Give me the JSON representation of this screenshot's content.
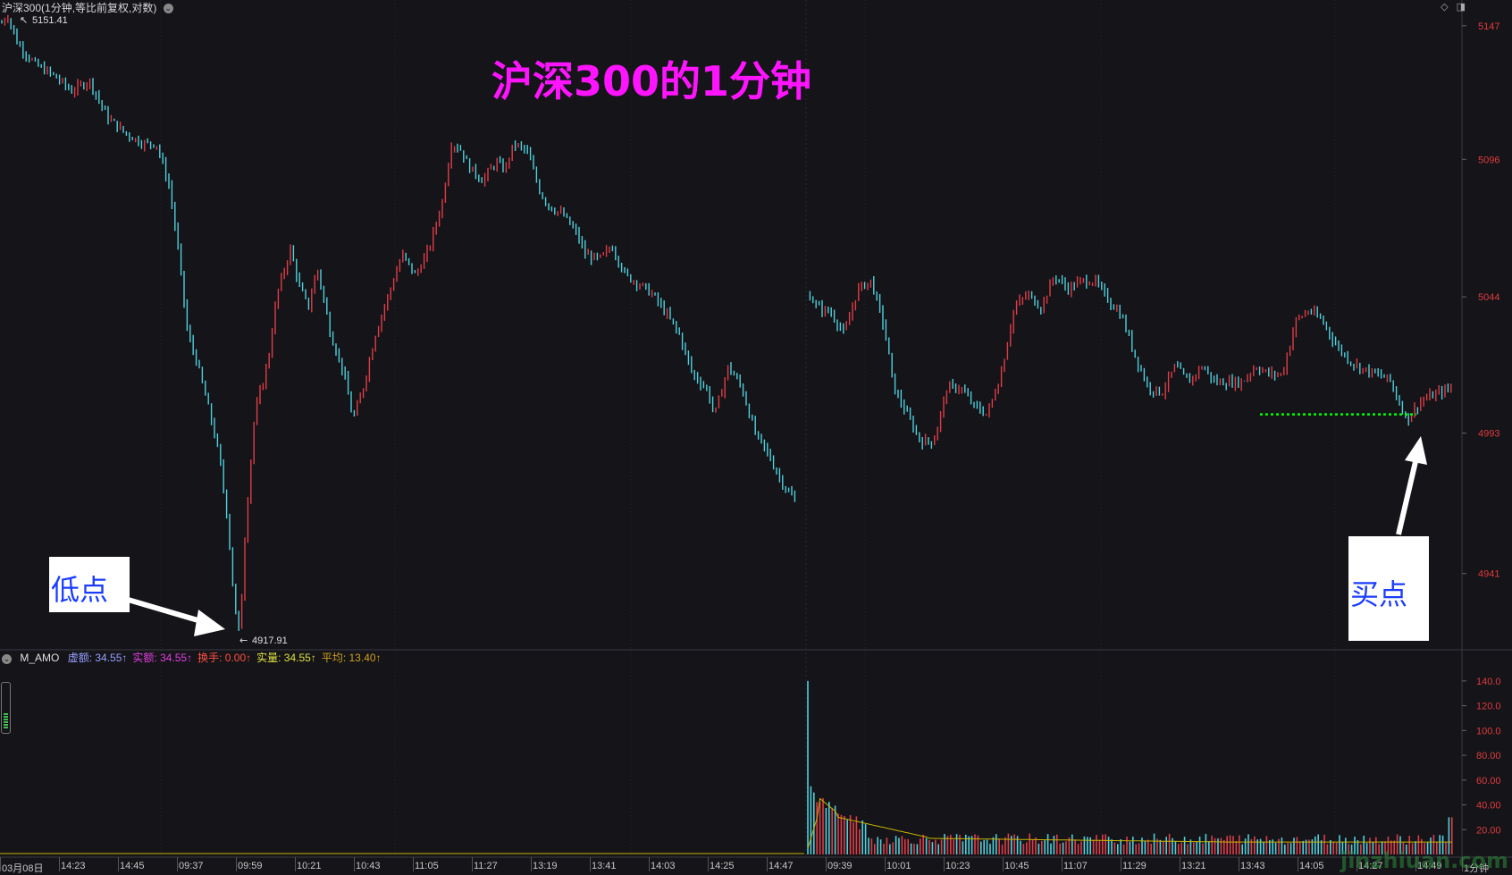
{
  "window": {
    "title": "沪深300(1分钟,等比前复权,对数)",
    "menu_icon": "chevron-down-icon",
    "controls": [
      "◇",
      "◨"
    ]
  },
  "headline": "沪深300的1分钟",
  "annotations": {
    "low_label": "低点",
    "buy_label": "买点",
    "high_price_label": "5151.41",
    "low_price_label": "4917.91"
  },
  "colors": {
    "background": "#141419",
    "up": "#e03c46",
    "down": "#4fd0dc",
    "headline": "#ff14ff",
    "support_line": "#00ff00",
    "avg_line": "#c8b400"
  },
  "price_axis": {
    "ticks": [
      "5147",
      "5096",
      "5044",
      "4993",
      "4941"
    ]
  },
  "volume_axis": {
    "ticks": [
      "140.0",
      "120.0",
      "100.0",
      "80.00",
      "60.00",
      "40.00",
      "20.00"
    ]
  },
  "indicator": {
    "name": "M_AMO",
    "items": [
      {
        "label": "虚额:",
        "value": "34.55↑",
        "color": "#9aa0ff"
      },
      {
        "label": "实额:",
        "value": "34.55↑",
        "color": "#e040e0"
      },
      {
        "label": "换手:",
        "value": "0.00↑",
        "color": "#ff5040"
      },
      {
        "label": "实量:",
        "value": "34.55↑",
        "color": "#e0e040"
      },
      {
        "label": "平均:",
        "value": "13.40↑",
        "color": "#d0a020"
      }
    ]
  },
  "time_axis": {
    "labels": [
      "03月08日",
      "14:23",
      "14:45",
      "09:37",
      "09:59",
      "10:21",
      "10:43",
      "11:05",
      "11:27",
      "13:19",
      "13:41",
      "14:03",
      "14:25",
      "14:47",
      "09:39",
      "10:01",
      "10:23",
      "10:45",
      "11:07",
      "11:29",
      "13:21",
      "13:43",
      "14:05",
      "14:27",
      "14:49",
      "1分钟"
    ]
  },
  "watermark": "jinzhiuan.com",
  "chart_data": {
    "type": "line",
    "title": "沪深300的1分钟",
    "y_scale": "log",
    "ylim": [
      4917.91,
      5151.41
    ],
    "price_points": [
      [
        0,
        5147
      ],
      [
        8,
        5151.41
      ],
      [
        20,
        5140
      ],
      [
        40,
        5132
      ],
      [
        60,
        5128
      ],
      [
        80,
        5122
      ],
      [
        100,
        5126
      ],
      [
        120,
        5112
      ],
      [
        140,
        5106
      ],
      [
        160,
        5102
      ],
      [
        175,
        5102
      ],
      [
        190,
        5085
      ],
      [
        200,
        5060
      ],
      [
        210,
        5030
      ],
      [
        220,
        5020
      ],
      [
        235,
        5000
      ],
      [
        245,
        4985
      ],
      [
        255,
        4960
      ],
      [
        262,
        4930
      ],
      [
        268,
        4917.91
      ],
      [
        275,
        4960
      ],
      [
        285,
        5000
      ],
      [
        300,
        5020
      ],
      [
        310,
        5045
      ],
      [
        325,
        5062
      ],
      [
        335,
        5048
      ],
      [
        345,
        5040
      ],
      [
        355,
        5055
      ],
      [
        370,
        5030
      ],
      [
        385,
        5015
      ],
      [
        395,
        4998
      ],
      [
        405,
        5008
      ],
      [
        420,
        5030
      ],
      [
        435,
        5045
      ],
      [
        450,
        5060
      ],
      [
        465,
        5052
      ],
      [
        480,
        5062
      ],
      [
        495,
        5080
      ],
      [
        505,
        5102
      ],
      [
        515,
        5100
      ],
      [
        525,
        5093
      ],
      [
        540,
        5088
      ],
      [
        555,
        5095
      ],
      [
        565,
        5092
      ],
      [
        575,
        5102
      ],
      [
        590,
        5099
      ],
      [
        605,
        5083
      ],
      [
        615,
        5078
      ],
      [
        630,
        5075
      ],
      [
        645,
        5068
      ],
      [
        655,
        5060
      ],
      [
        670,
        5058
      ],
      [
        685,
        5063
      ],
      [
        700,
        5052
      ],
      [
        715,
        5049
      ],
      [
        730,
        5045
      ],
      [
        745,
        5038
      ],
      [
        760,
        5030
      ],
      [
        775,
        5015
      ],
      [
        790,
        5010
      ],
      [
        800,
        5000
      ],
      [
        815,
        5018
      ],
      [
        830,
        5010
      ],
      [
        845,
        4993
      ],
      [
        860,
        4985
      ],
      [
        870,
        4978
      ],
      [
        880,
        4972
      ],
      [
        890,
        4968
      ],
      [
        900,
        4962
      ],
      [
        905,
        5045
      ],
      [
        915,
        5040
      ],
      [
        930,
        5038
      ],
      [
        945,
        5030
      ],
      [
        960,
        5047
      ],
      [
        975,
        5050
      ],
      [
        990,
        5032
      ],
      [
        1000,
        5010
      ],
      [
        1015,
        5000
      ],
      [
        1030,
        4990
      ],
      [
        1045,
        4990
      ],
      [
        1060,
        5010
      ],
      [
        1075,
        5010
      ],
      [
        1090,
        5003
      ],
      [
        1105,
        5000
      ],
      [
        1120,
        5015
      ],
      [
        1135,
        5040
      ],
      [
        1150,
        5045
      ],
      [
        1165,
        5040
      ],
      [
        1180,
        5052
      ],
      [
        1195,
        5047
      ],
      [
        1210,
        5050
      ],
      [
        1225,
        5050
      ],
      [
        1240,
        5043
      ],
      [
        1255,
        5037
      ],
      [
        1270,
        5022
      ],
      [
        1285,
        5010
      ],
      [
        1300,
        5008
      ],
      [
        1315,
        5018
      ],
      [
        1330,
        5012
      ],
      [
        1345,
        5018
      ],
      [
        1360,
        5012
      ],
      [
        1375,
        5012
      ],
      [
        1390,
        5012
      ],
      [
        1405,
        5018
      ],
      [
        1420,
        5015
      ],
      [
        1435,
        5015
      ],
      [
        1450,
        5035
      ],
      [
        1465,
        5039
      ],
      [
        1480,
        5035
      ],
      [
        1495,
        5026
      ],
      [
        1510,
        5020
      ],
      [
        1525,
        5017
      ],
      [
        1540,
        5015
      ],
      [
        1555,
        5013
      ],
      [
        1565,
        5005
      ],
      [
        1575,
        4998
      ],
      [
        1590,
        5005
      ],
      [
        1610,
        5008
      ],
      [
        1625,
        5010
      ]
    ],
    "support_level": 5000,
    "volume_peak": 140.0
  }
}
